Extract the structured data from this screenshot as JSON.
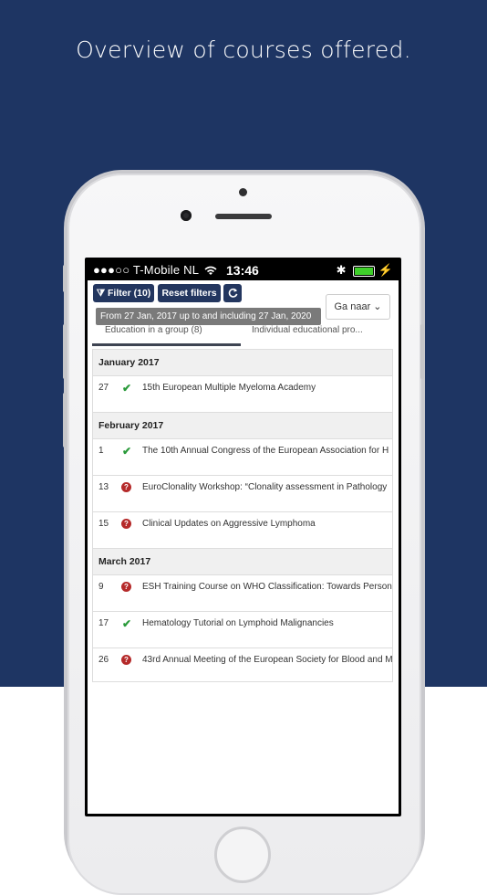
{
  "headline": "Overview of courses offered.",
  "status_bar": {
    "signal": "●●●○○",
    "carrier": "T-Mobile NL",
    "time": "13:46",
    "bluetooth": "✱",
    "battery_charge": 1.0
  },
  "toolbar": {
    "filter_label": "Filter (10)",
    "reset_label": "Reset filters",
    "refresh_icon": "refresh-icon",
    "goto_label": "Ga naar",
    "date_range_tooltip": "From 27 Jan, 2017 up to and including 27 Jan, 2020"
  },
  "tabs": {
    "first": "Education in a group (8)",
    "second": "Individual educational pro..."
  },
  "months": [
    {
      "label": "January 2017",
      "items": [
        {
          "day": "27",
          "status": "ok",
          "title": "15th European Multiple Myeloma Academy"
        }
      ]
    },
    {
      "label": "February 2017",
      "items": [
        {
          "day": "1",
          "status": "ok",
          "title": "The 10th Annual Congress of the European Association for H"
        },
        {
          "day": "13",
          "status": "warn",
          "title": "EuroClonality Workshop: “Clonality assessment in Pathology"
        },
        {
          "day": "15",
          "status": "warn",
          "title": "Clinical Updates on Aggressive Lymphoma"
        }
      ]
    },
    {
      "label": "March 2017",
      "items": [
        {
          "day": "9",
          "status": "warn",
          "title": "ESH Training Course on WHO Classification: Towards Person"
        },
        {
          "day": "17",
          "status": "ok",
          "title": "Hematology Tutorial on Lymphoid Malignancies"
        },
        {
          "day": "26",
          "status": "warn",
          "title": "43rd Annual Meeting of the European Society for Blood and M"
        }
      ]
    }
  ],
  "colors": {
    "background_top": "#1e3563",
    "button": "#23365f",
    "ok": "#2a9a3a",
    "warn": "#b52a2a"
  }
}
